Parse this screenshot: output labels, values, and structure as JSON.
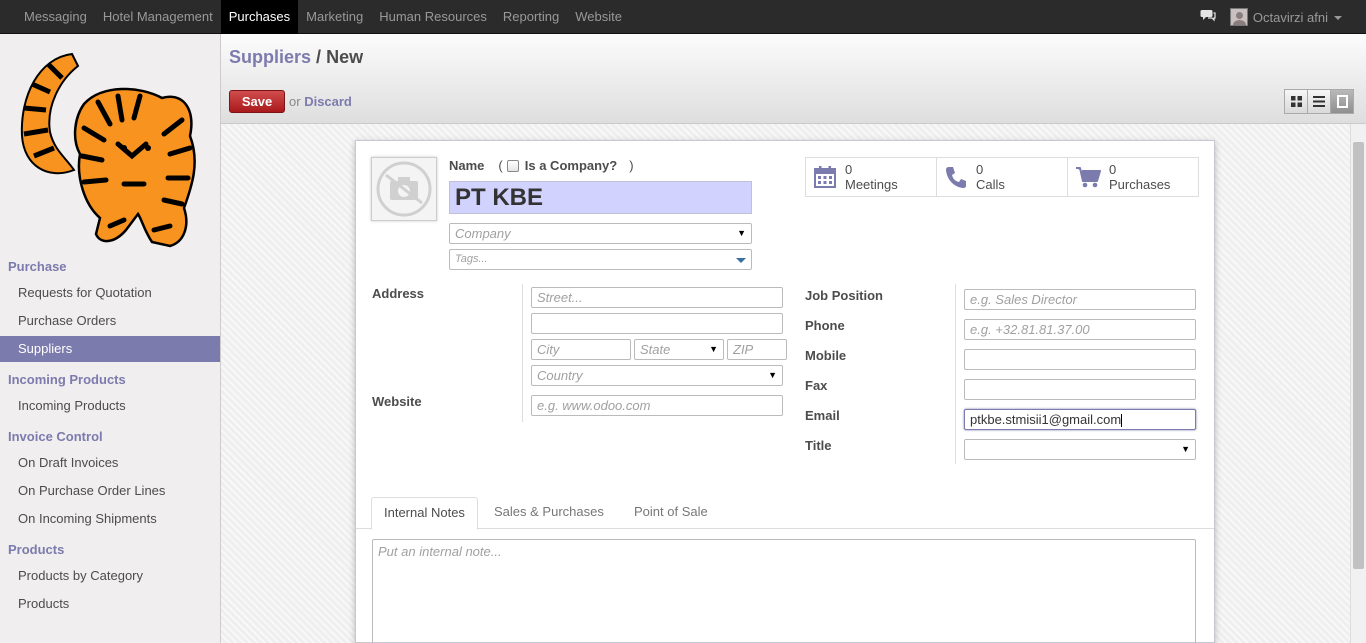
{
  "topbar": {
    "menu": [
      "Messaging",
      "Hotel Management",
      "Purchases",
      "Marketing",
      "Human Resources",
      "Reporting",
      "Website"
    ],
    "active_menu": "Purchases",
    "user": "Octavirzi afni"
  },
  "sidebar": {
    "sections": [
      {
        "title": "Purchase",
        "items": [
          "Requests for Quotation",
          "Purchase Orders",
          "Suppliers"
        ]
      },
      {
        "title": "Incoming Products",
        "items": [
          "Incoming Products"
        ]
      },
      {
        "title": "Invoice Control",
        "items": [
          "On Draft Invoices",
          "On Purchase Order Lines",
          "On Incoming Shipments"
        ]
      },
      {
        "title": "Products",
        "items": [
          "Products by Category",
          "Products"
        ]
      }
    ],
    "active_item": "Suppliers"
  },
  "breadcrumb": {
    "parent": "Suppliers",
    "separator": "/",
    "current": "New"
  },
  "actions": {
    "save": "Save",
    "or": "or",
    "discard": "Discard"
  },
  "form": {
    "name_label": "Name",
    "paren_open": "(",
    "paren_close": ")",
    "is_company_label": "Is a Company?",
    "is_company_checked": false,
    "name_value": "PT KBE",
    "company_placeholder": "Company",
    "tags_placeholder": "Tags...",
    "address_label": "Address",
    "street_placeholder": "Street...",
    "street2_value": "",
    "city_placeholder": "City",
    "state_placeholder": "State",
    "zip_placeholder": "ZIP",
    "country_placeholder": "Country",
    "website_label": "Website",
    "website_placeholder": "e.g. www.odoo.com",
    "job_position_label": "Job Position",
    "job_position_placeholder": "e.g. Sales Director",
    "phone_label": "Phone",
    "phone_placeholder": "e.g. +32.81.81.37.00",
    "mobile_label": "Mobile",
    "mobile_value": "",
    "fax_label": "Fax",
    "fax_value": "",
    "email_label": "Email",
    "email_value": "ptkbe.stmisii1@gmail.com",
    "title_label": "Title",
    "title_value": ""
  },
  "stats": [
    {
      "count": "0",
      "label": "Meetings",
      "icon": "calendar-icon"
    },
    {
      "count": "0",
      "label": "Calls",
      "icon": "phone-icon"
    },
    {
      "count": "0",
      "label": "Purchases",
      "icon": "cart-icon"
    }
  ],
  "tabs": [
    "Internal Notes",
    "Sales & Purchases",
    "Point of Sale"
  ],
  "active_tab": "Internal Notes",
  "notes_placeholder": "Put an internal note...",
  "colors": {
    "accent": "#7c7bad",
    "save": "#b52121",
    "topbar": "#2b2b2b",
    "name_bg": "#d2d2ff"
  }
}
